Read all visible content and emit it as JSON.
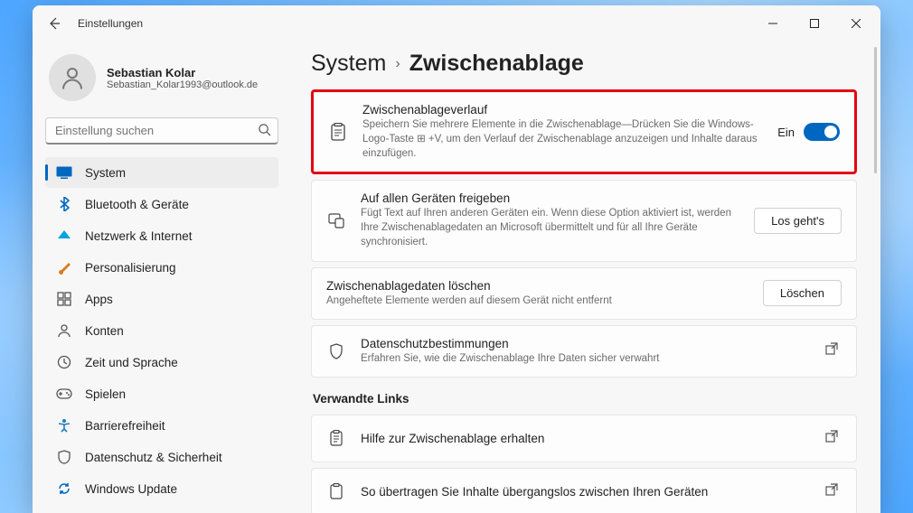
{
  "window": {
    "title": "Einstellungen"
  },
  "user": {
    "name": "Sebastian Kolar",
    "email": "Sebastian_Kolar1993@outlook.de"
  },
  "search": {
    "placeholder": "Einstellung suchen"
  },
  "nav": {
    "items": [
      {
        "label": "System",
        "icon": "system",
        "color": "#0067c0",
        "active": true
      },
      {
        "label": "Bluetooth & Geräte",
        "icon": "bluetooth",
        "color": "#0067c0"
      },
      {
        "label": "Netzwerk & Internet",
        "icon": "network",
        "color": "#00a3e0"
      },
      {
        "label": "Personalisierung",
        "icon": "personalize",
        "color": "#d97b1f"
      },
      {
        "label": "Apps",
        "icon": "apps",
        "color": "#555"
      },
      {
        "label": "Konten",
        "icon": "accounts",
        "color": "#555"
      },
      {
        "label": "Zeit und Sprache",
        "icon": "time",
        "color": "#555"
      },
      {
        "label": "Spielen",
        "icon": "gaming",
        "color": "#555"
      },
      {
        "label": "Barrierefreiheit",
        "icon": "accessibility",
        "color": "#1f7bbf"
      },
      {
        "label": "Datenschutz & Sicherheit",
        "icon": "privacy",
        "color": "#555"
      },
      {
        "label": "Windows Update",
        "icon": "update",
        "color": "#0067c0"
      }
    ]
  },
  "breadcrumb": {
    "parent": "System",
    "current": "Zwischenablage"
  },
  "cards": {
    "history": {
      "title": "Zwischenablageverlauf",
      "desc": "Speichern Sie mehrere Elemente in die Zwischenablage—Drücken Sie die Windows-Logo-Taste ⊞ +V, um den Verlauf der Zwischenablage anzuzeigen und Inhalte daraus einzufügen.",
      "toggle_label": "Ein",
      "toggle_on": true
    },
    "share": {
      "title": "Auf allen Geräten freigeben",
      "desc": "Fügt Text auf Ihren anderen Geräten ein. Wenn diese Option aktiviert ist, werden Ihre Zwischenablagedaten an Microsoft übermittelt und für all Ihre Geräte synchronisiert.",
      "button": "Los geht's"
    },
    "clear": {
      "title": "Zwischenablagedaten löschen",
      "desc": "Angeheftete Elemente werden auf diesem Gerät nicht entfernt",
      "button": "Löschen"
    },
    "privacy": {
      "title": "Datenschutzbestimmungen",
      "desc": "Erfahren Sie, wie die Zwischenablage Ihre Daten sicher verwahrt"
    }
  },
  "related": {
    "heading": "Verwandte Links",
    "help": "Hilfe zur Zwischenablage erhalten",
    "transfer": "So übertragen Sie Inhalte übergangslos zwischen Ihren Geräten"
  }
}
